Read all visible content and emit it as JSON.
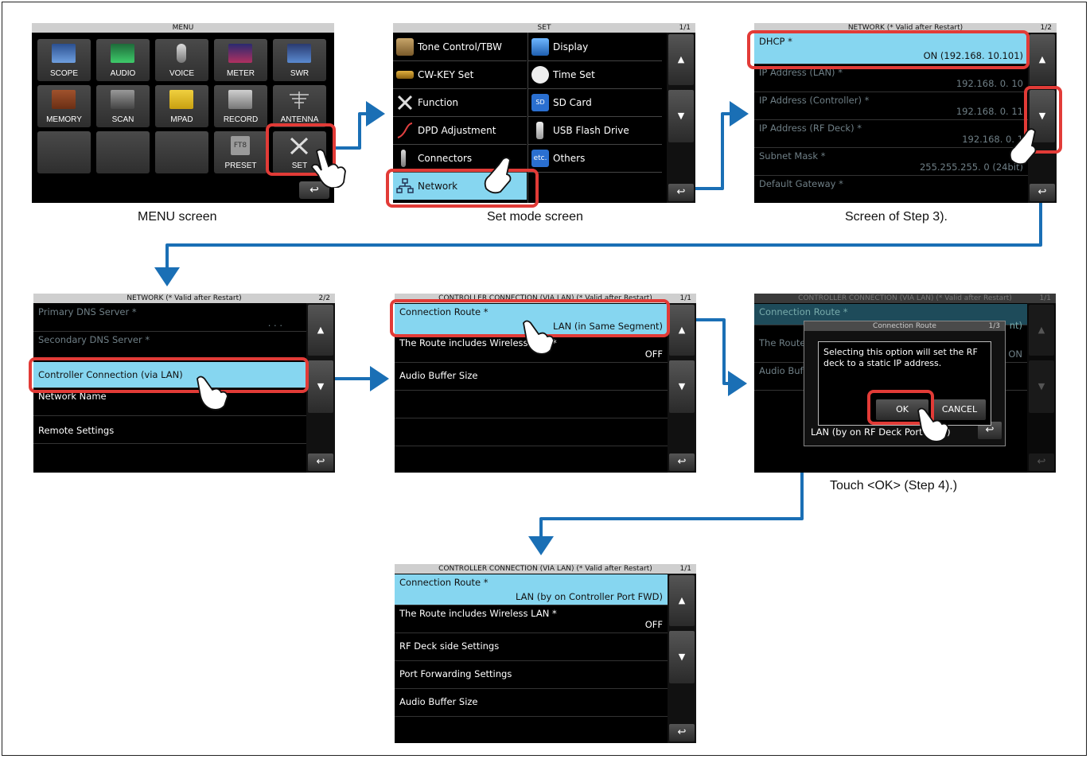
{
  "menu_screen": {
    "title": "MENU",
    "buttons": [
      "SCOPE",
      "AUDIO",
      "VOICE",
      "METER",
      "SWR",
      "MEMORY",
      "SCAN",
      "MPAD",
      "RECORD",
      "ANTENNA",
      "PRESET",
      "SET"
    ],
    "preset_badge": "FT8",
    "back": "↩",
    "caption": "MENU screen"
  },
  "set_screen": {
    "title": "SET",
    "page": "1/1",
    "items": [
      "Tone Control/TBW",
      "Display",
      "CW-KEY Set",
      "Time Set",
      "Function",
      "SD Card",
      "DPD Adjustment",
      "USB Flash Drive",
      "Connectors",
      "Others",
      "Network"
    ],
    "sd_badge": "SD",
    "etc_badge": "etc.",
    "caption": "Set mode screen"
  },
  "network1_screen": {
    "title": "NETWORK (* Valid after Restart)",
    "page": "1/2",
    "rows": [
      {
        "label": "DHCP *",
        "value": "ON (192.168.  10.101)"
      },
      {
        "label": "IP Address (LAN) *",
        "value": "192.168.   0.  10"
      },
      {
        "label": "IP Address (Controller) *",
        "value": "192.168.   0.  11"
      },
      {
        "label": "IP Address (RF Deck) *",
        "value": "192.168.   0.  1"
      },
      {
        "label": "Subnet Mask *",
        "value": "255.255.255.   0 (24bit)"
      },
      {
        "label": "Default Gateway *",
        "value": ""
      }
    ],
    "caption": "Screen of Step 3)."
  },
  "network2_screen": {
    "title": "NETWORK (* Valid after Restart)",
    "page": "2/2",
    "rows": [
      {
        "label": "Primary DNS Server *",
        "value": ".   .   ."
      },
      {
        "label": "Secondary DNS Server *",
        "value": ""
      },
      {
        "label": "Controller Connection (via LAN)",
        "value": ""
      },
      {
        "label": "Network Name",
        "value": ""
      },
      {
        "label": "Remote Settings",
        "value": ""
      }
    ]
  },
  "ccon1_screen": {
    "title": "CONTROLLER CONNECTION (VIA LAN) (* Valid after Restart)",
    "page": "1/1",
    "rows": [
      {
        "label": "Connection Route *",
        "value": "LAN (in Same Segment)"
      },
      {
        "label": "The Route includes Wireless LAN *",
        "value": "OFF"
      },
      {
        "label": "Audio Buffer Size",
        "value": ""
      }
    ]
  },
  "ccon2_screen": {
    "title": "CONTROLLER CONNECTION (VIA LAN) (* Valid after Restart)",
    "page": "1/1",
    "bg_rows": [
      "Connection Route *",
      "The Route",
      "Audio Buf"
    ],
    "bg_value_fragment": "nt)",
    "bg_on": "ON",
    "popup_title": "Connection Route",
    "popup_page": "1/3",
    "popup_list_last": "LAN (by on RF Deck Port FWD)",
    "dialog_text": "Selecting this option will set the RF deck to a static IP address.",
    "ok": "OK",
    "cancel": "CANCEL",
    "caption": "Touch <OK> (Step 4).)"
  },
  "ccon3_screen": {
    "title": "CONTROLLER CONNECTION (VIA LAN) (* Valid after Restart)",
    "page": "1/1",
    "rows": [
      {
        "label": "Connection Route *",
        "value": "LAN (by on Controller Port FWD)"
      },
      {
        "label": "The Route includes Wireless LAN *",
        "value": "OFF"
      },
      {
        "label": "RF Deck side Settings",
        "value": ""
      },
      {
        "label": "Port Forwarding Settings",
        "value": ""
      },
      {
        "label": "Audio Buffer Size",
        "value": ""
      }
    ]
  },
  "colors": {
    "highlight": "#86d6f0",
    "callout": "#e23b37",
    "arrow": "#1a6fb5"
  }
}
